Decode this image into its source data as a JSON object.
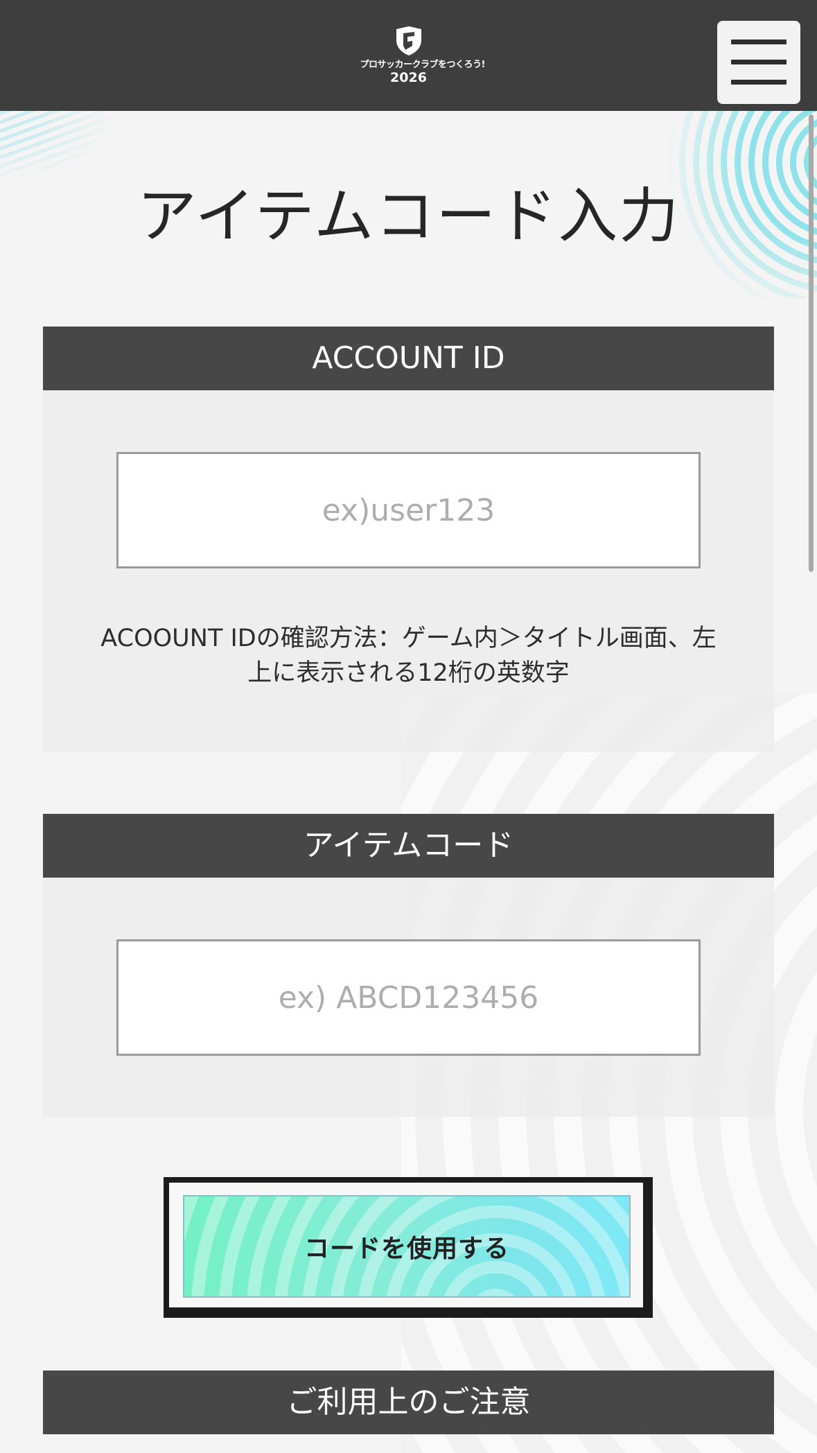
{
  "header": {
    "logo_title": "プロサッカークラブをつくろう!",
    "logo_year": "2026",
    "menu_icon": "hamburger-menu-icon"
  },
  "page": {
    "title": "アイテムコード入力"
  },
  "account_section": {
    "header": "ACCOUNT ID",
    "input_value": "",
    "input_placeholder": "ex)user123",
    "help_text": "ACOOUNT IDの確認方法：ゲーム内＞タイトル画面、左上に表示される12桁の英数字"
  },
  "item_code_section": {
    "header": "アイテムコード",
    "input_value": "",
    "input_placeholder": "ex) ABCD123456"
  },
  "submit": {
    "label": "コードを使用する"
  },
  "notice_section": {
    "header": "ご利用上のご注意"
  },
  "colors": {
    "header_bg": "#3e3e3e",
    "section_header_bg": "#474747",
    "page_bg": "#f4f4f4",
    "button_gradient_start": "#74f0c4",
    "button_gradient_end": "#7fe8f6"
  }
}
